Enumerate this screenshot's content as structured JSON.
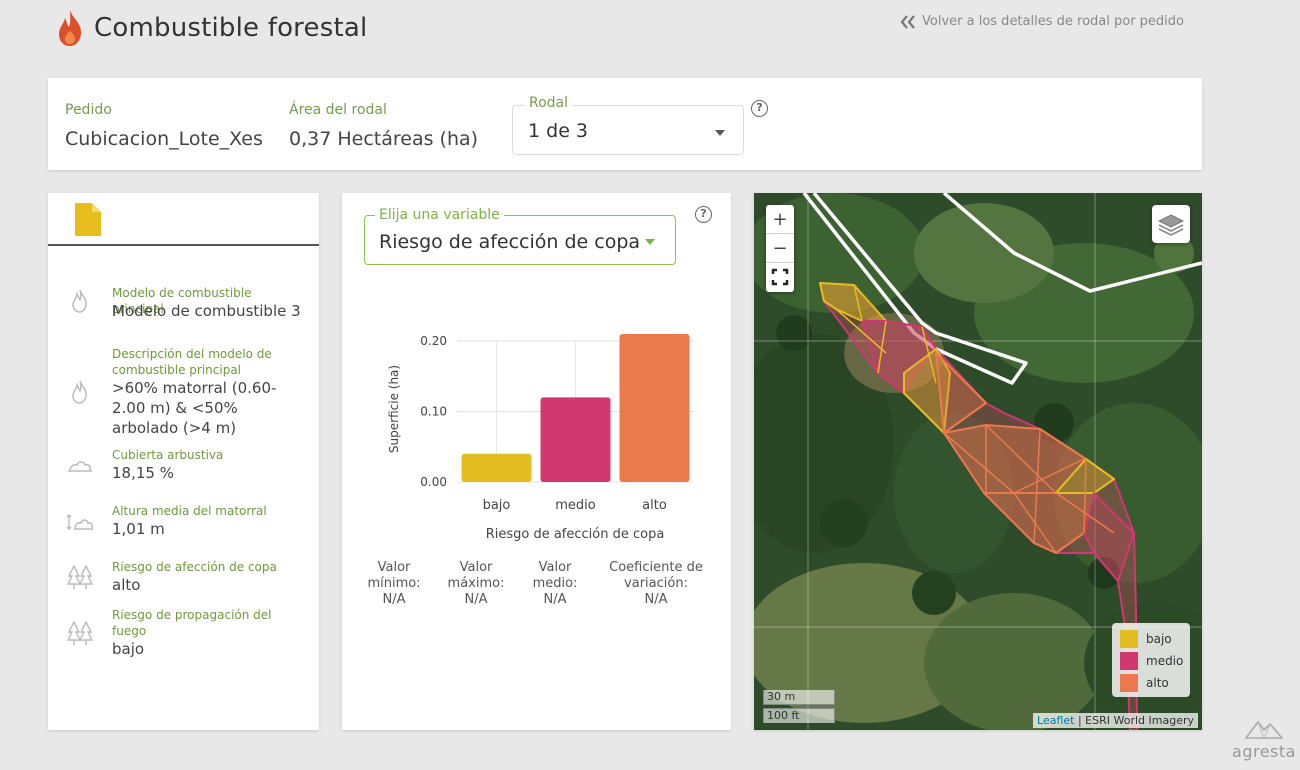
{
  "header": {
    "title": "Combustible forestal",
    "back_link": "Volver a los detalles de rodal por pedido"
  },
  "summary": {
    "pedido_label": "Pedido",
    "pedido_value": "Cubicacion_Lote_Xes",
    "area_label": "Área del rodal",
    "area_value": "0,37 Hectáreas (ha)",
    "rodal_label": "Rodal",
    "rodal_value": "1 de 3"
  },
  "properties": [
    {
      "icon": "flame-outline-icon",
      "label": "Modelo de combustible principal",
      "value": "Modelo de combustible 3"
    },
    {
      "icon": "flame-outline-icon",
      "label": "Descripción del modelo de combustible principal",
      "value": ">60% matorral (0.60-2.00 m) & <50% arbolado (>4 m)"
    },
    {
      "icon": "shrub-cover-icon",
      "label": "Cubierta arbustiva",
      "value": "18,15 %"
    },
    {
      "icon": "shrub-height-icon",
      "label": "Altura media del matorral",
      "value": "1,01 m"
    },
    {
      "icon": "tree-canopy-icon",
      "label": "Riesgo de afección de copa",
      "value": "alto"
    },
    {
      "icon": "tree-fire-spread-icon",
      "label": "Riesgo de propagación del fuego",
      "value": "bajo"
    }
  ],
  "variable_select": {
    "label": "Elija una variable",
    "value": "Riesgo de afección de copa"
  },
  "chart_data": {
    "type": "bar",
    "categories": [
      "bajo",
      "medio",
      "alto"
    ],
    "values": [
      0.04,
      0.12,
      0.21
    ],
    "colors": [
      "#e4bd22",
      "#d0386f",
      "#ea7a4c"
    ],
    "xlabel": "Riesgo de afección de copa",
    "ylabel": "Superficie (ha)",
    "ylim": [
      0,
      0.2
    ],
    "yticks": [
      "0.00",
      "0.10",
      "0.20"
    ],
    "grid": true
  },
  "stats": [
    {
      "label": "Valor mínimo:",
      "value": "N/A"
    },
    {
      "label": "Valor máximo:",
      "value": "N/A"
    },
    {
      "label": "Valor medio:",
      "value": "N/A"
    },
    {
      "label": "Coeficiente de variación:",
      "value": "N/A"
    }
  ],
  "map": {
    "zoom_in": "+",
    "zoom_out": "−",
    "legend": [
      {
        "label": "bajo",
        "color": "#e4bd22"
      },
      {
        "label": "medio",
        "color": "#d0386f"
      },
      {
        "label": "alto",
        "color": "#ea7a4c"
      }
    ],
    "scale_metric": "30 m",
    "scale_imperial": "100 ft",
    "attribution_link": "Leaflet",
    "attribution_text": "| ESRI World Imagery"
  },
  "brand": {
    "name": "agresta"
  }
}
